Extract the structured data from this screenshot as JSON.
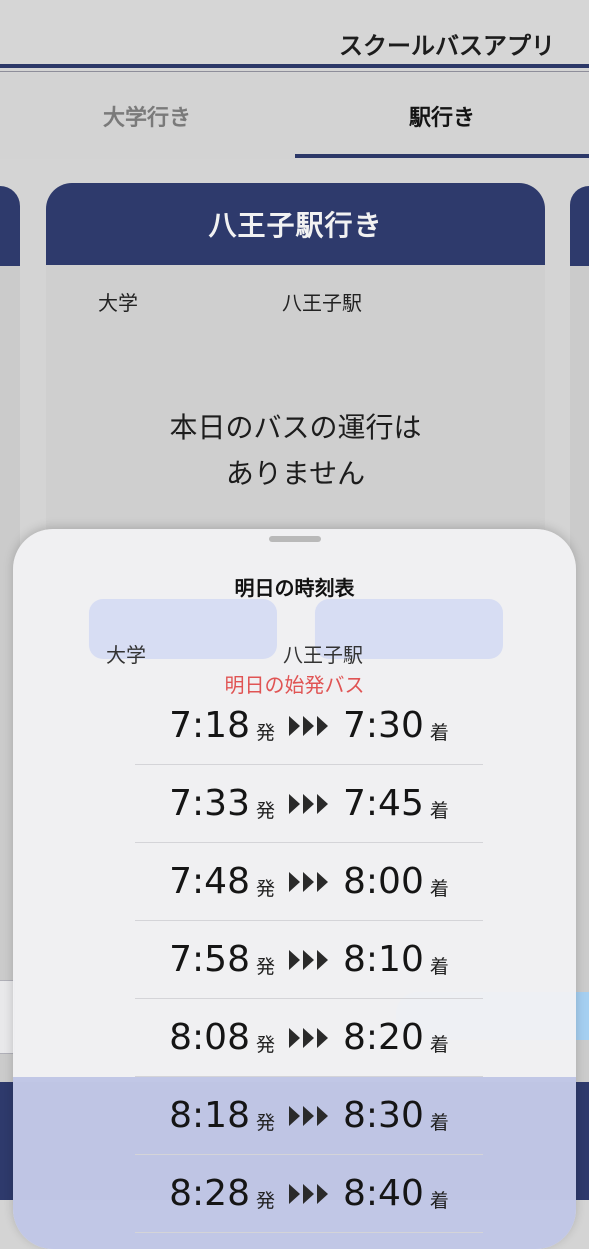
{
  "app": {
    "title": "スクールバスアプリ"
  },
  "tabs": [
    {
      "label": "大学行き",
      "selected": false
    },
    {
      "label": "駅行き",
      "selected": true
    }
  ],
  "card": {
    "title": "八王子駅行き",
    "from_label": "大学",
    "to_label": "八王子駅",
    "message_line1": "本日のバスの運行は",
    "message_line2": "ありません"
  },
  "sheet": {
    "title": "明日の時刻表",
    "from_label": "大学",
    "to_label": "八王子駅",
    "first_bus_label": "明日の始発バス",
    "depart_suffix": "発",
    "arrive_suffix": "着",
    "rows": [
      {
        "depart": "7:18",
        "arrive": "7:30"
      },
      {
        "depart": "7:33",
        "arrive": "7:45"
      },
      {
        "depart": "7:48",
        "arrive": "8:00"
      },
      {
        "depart": "7:58",
        "arrive": "8:10"
      },
      {
        "depart": "8:08",
        "arrive": "8:20"
      },
      {
        "depart": "8:18",
        "arrive": "8:30"
      },
      {
        "depart": "8:28",
        "arrive": "8:40"
      }
    ]
  },
  "colors": {
    "navy": "#2e3a6c",
    "first_bus_red": "#e05454",
    "background_gray": "#d4d4d4"
  }
}
